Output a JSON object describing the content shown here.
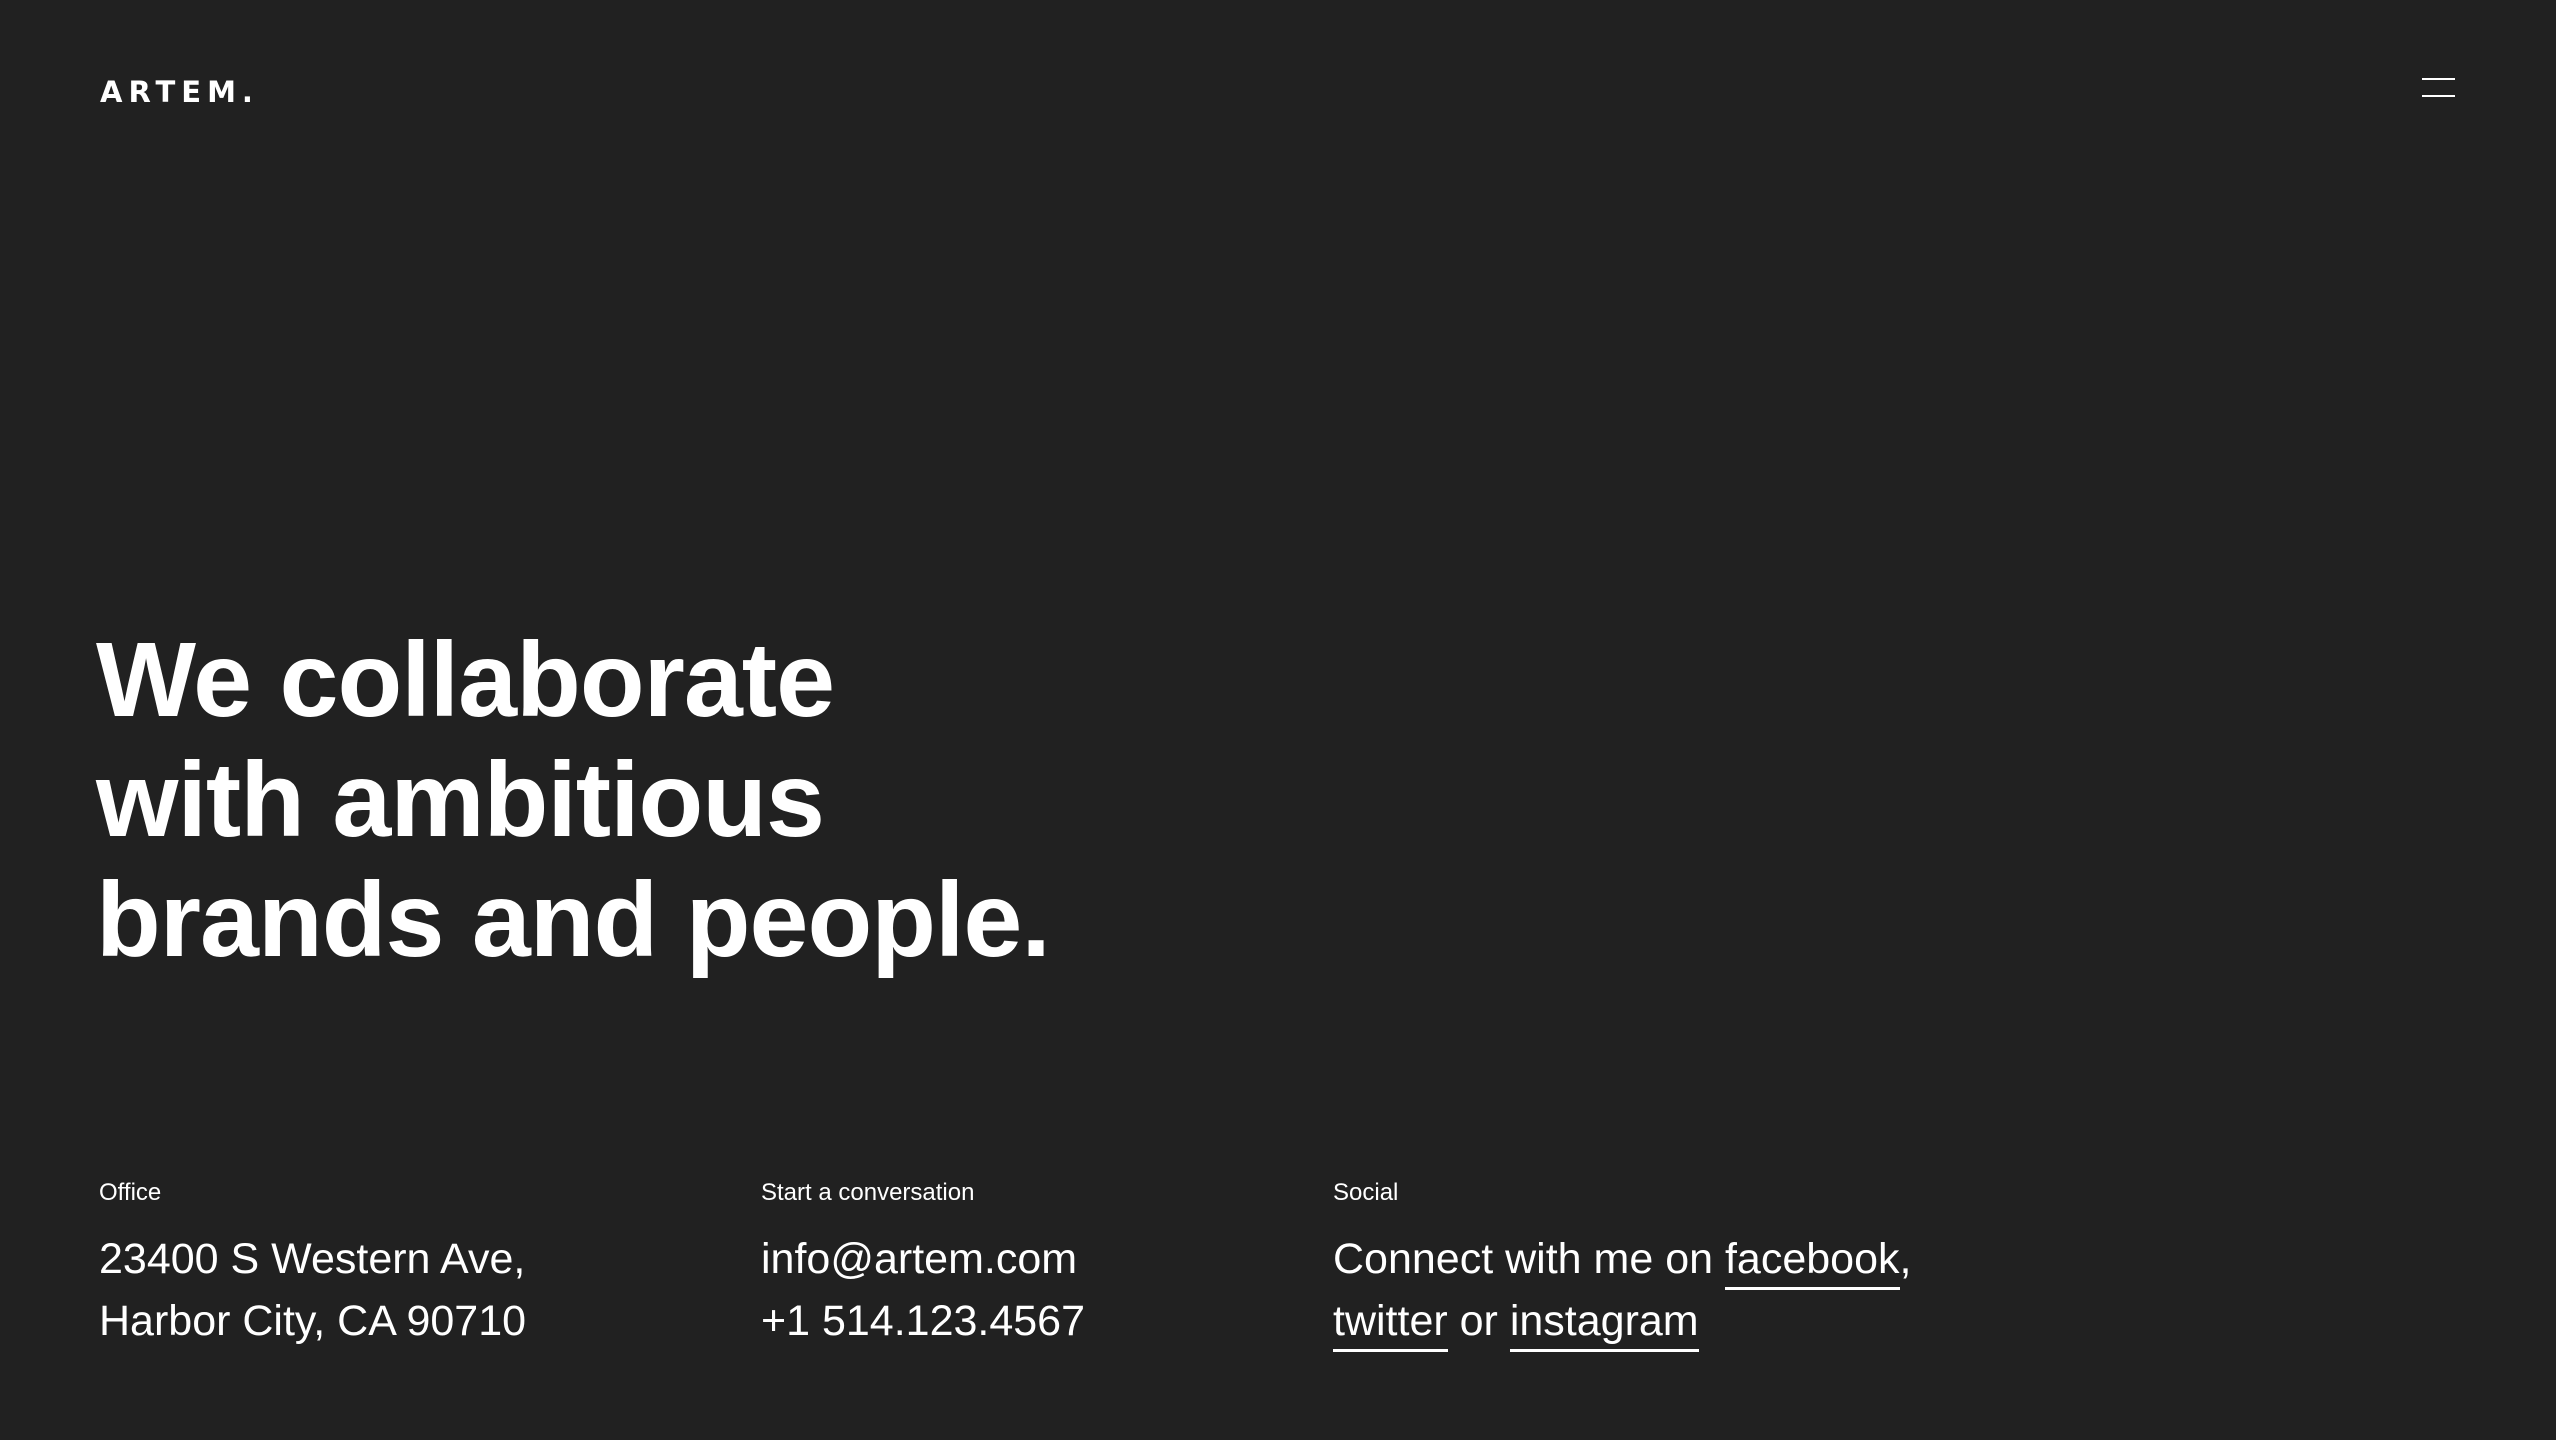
{
  "header": {
    "logo_text": "ARTEM.",
    "menu_icon": "hamburger-icon"
  },
  "hero": {
    "lines": [
      "We collaborate",
      "with ambitious",
      "brands and people."
    ]
  },
  "footer": {
    "office": {
      "label": "Office",
      "address_line_1": "23400 S Western Ave,",
      "address_line_2": "Harbor City, CA 90710"
    },
    "contact": {
      "label": "Start a conversation",
      "email": "info@artem.com",
      "phone": "+1 514.123.4567"
    },
    "social": {
      "label": "Social",
      "intro": "Connect with me on ",
      "facebook": "facebook",
      "comma": ",",
      "twitter": "twitter",
      "or": " or ",
      "instagram": "instagram"
    }
  },
  "colors": {
    "background": "#212121",
    "text": "#ffffff"
  }
}
